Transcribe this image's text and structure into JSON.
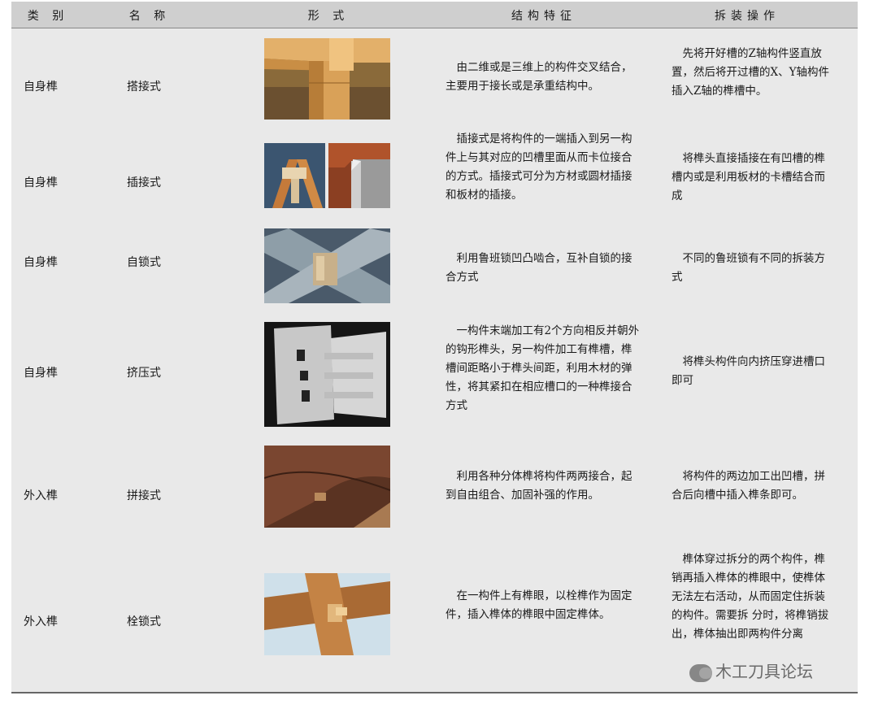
{
  "headers": {
    "category": "类 别",
    "name": "名 称",
    "form": "形 式",
    "structure": "结构特征",
    "operation": "拆装操作"
  },
  "rows": [
    {
      "category": "自身榫",
      "name": "搭接式",
      "image": "lap-joint-photo",
      "structure": "由二维或是三维上的构件交叉结合，主要用于接长或是承重结构中。",
      "operation": "先将开好槽的Z轴构件竖直放置，然后将开过槽的X、Y轴构件插入Z轴的榫槽中。"
    },
    {
      "category": "自身榫",
      "name": "插接式",
      "image": "insert-joint-photos",
      "structure": "插接式是将构件的一端插入到另一构件上与其对应的凹槽里面从而卡位接合的方式。插接式可分为方材或圆材插接和板材的插接。",
      "operation": "将榫头直接插接在有凹槽的榫槽内或是利用板材的卡槽结合而成"
    },
    {
      "category": "自身榫",
      "name": "自锁式",
      "image": "self-lock-joint-photo",
      "structure": "利用鲁班锁凹凸啮合，互补自锁的接合方式",
      "operation": "不同的鲁班锁有不同的拆装方式"
    },
    {
      "category": "自身榫",
      "name": "挤压式",
      "image": "squeeze-joint-photo",
      "structure": "一构件末端加工有2个方向相反并朝外的钩形榫头，另一构件加工有榫槽，榫槽间距略小于榫头间距，利用木材的弹性，将其紧扣在相应槽口的一种榫接合方式",
      "operation": "将榫头构件向内挤压穿进槽口即可"
    },
    {
      "category": "外入榫",
      "name": "拼接式",
      "image": "splice-joint-photo",
      "structure": "利用各种分体榫将构件两两接合，起到自由组合、加固补强的作用。",
      "operation": "将构件的两边加工出凹槽，拼合后向槽中插入榫条即可。"
    },
    {
      "category": "外入榫",
      "name": "栓锁式",
      "image": "bolt-lock-joint-photo",
      "structure": "在一构件上有榫眼，以栓榫作为固定件，插入榫体的榫眼中固定榫体。",
      "operation": "榫体穿过拆分的两个构件，榫销再插入榫体的榫眼中，使榫体无法左右活动，从而固定住拆装的构件。需要拆 分时，将榫销拔出，榫体抽出即两构件分离"
    }
  ],
  "watermark": "木工刀具论坛"
}
